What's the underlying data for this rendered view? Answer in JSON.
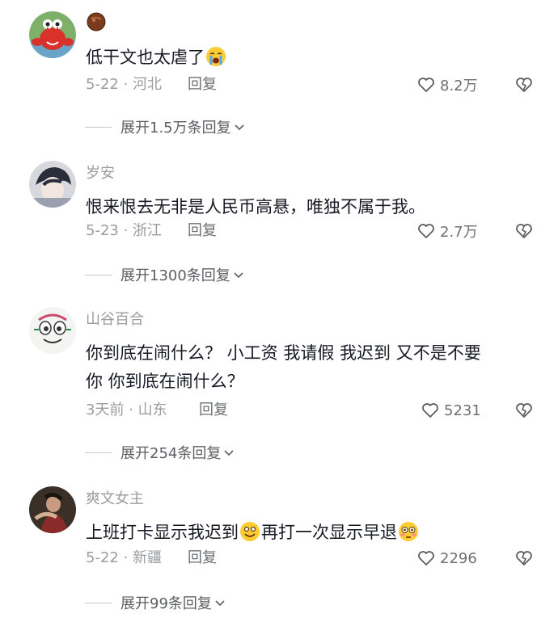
{
  "comments": [
    {
      "username": "",
      "text": "低干文也太虐了",
      "time_location": "5-22 · 河北",
      "reply": "回复",
      "likes": "8.2万",
      "expand": "展开1.5万条回复"
    },
    {
      "username": "岁安",
      "text": "恨来恨去无非是人民币高悬，唯独不属于我。",
      "time_location": "5-23 · 浙江",
      "reply": "回复",
      "likes": "2.7万",
      "expand": "展开1300条回复"
    },
    {
      "username": "山谷百合",
      "text_line1": "你到底在闹什么？ 小工资 我请假 我迟到 又不是不要",
      "text_line2": "你 你到底在闹什么？",
      "time_location": "3天前 · 山东",
      "reply": "回复",
      "likes": "5231",
      "expand": "展开254条回复"
    },
    {
      "username": "爽文女主",
      "text_part1": "上班打卡显示我迟到",
      "text_part2": "再打一次显示早退",
      "time_location": "5-22 · 新疆",
      "reply": "回复",
      "likes": "2296",
      "expand": "展开99条回复"
    }
  ],
  "colors": {
    "text": "#161823",
    "meta": "#9b9ca0",
    "action": "#6e6f73"
  }
}
